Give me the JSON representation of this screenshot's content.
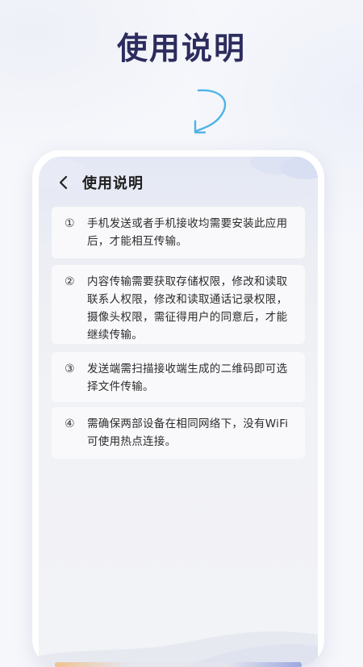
{
  "promo": {
    "title": "使用说明"
  },
  "screen": {
    "nav": {
      "title": "使用说明"
    },
    "cards": [
      {
        "num": "①",
        "text": "手机发送或者手机接收均需要安装此应用后，才能相互传输。"
      },
      {
        "num": "②",
        "text": "内容传输需要获取存储权限，修改和读取联系人权限，修改和读取通话记录权限，摄像头权限，需征得用户的同意后，才能继续传输。"
      },
      {
        "num": "③",
        "text": "发送端需扫描接收端生成的二维码即可选择文件传输。"
      },
      {
        "num": "④",
        "text": "需确保两部设备在相同网络下，没有WiFi可使用热点连接。"
      }
    ]
  },
  "colors": {
    "title": "#2d2c5e",
    "arrow": "#4fb3e6"
  },
  "icons": {
    "back": "chevron-left-icon",
    "arrow": "curved-arrow-icon"
  }
}
